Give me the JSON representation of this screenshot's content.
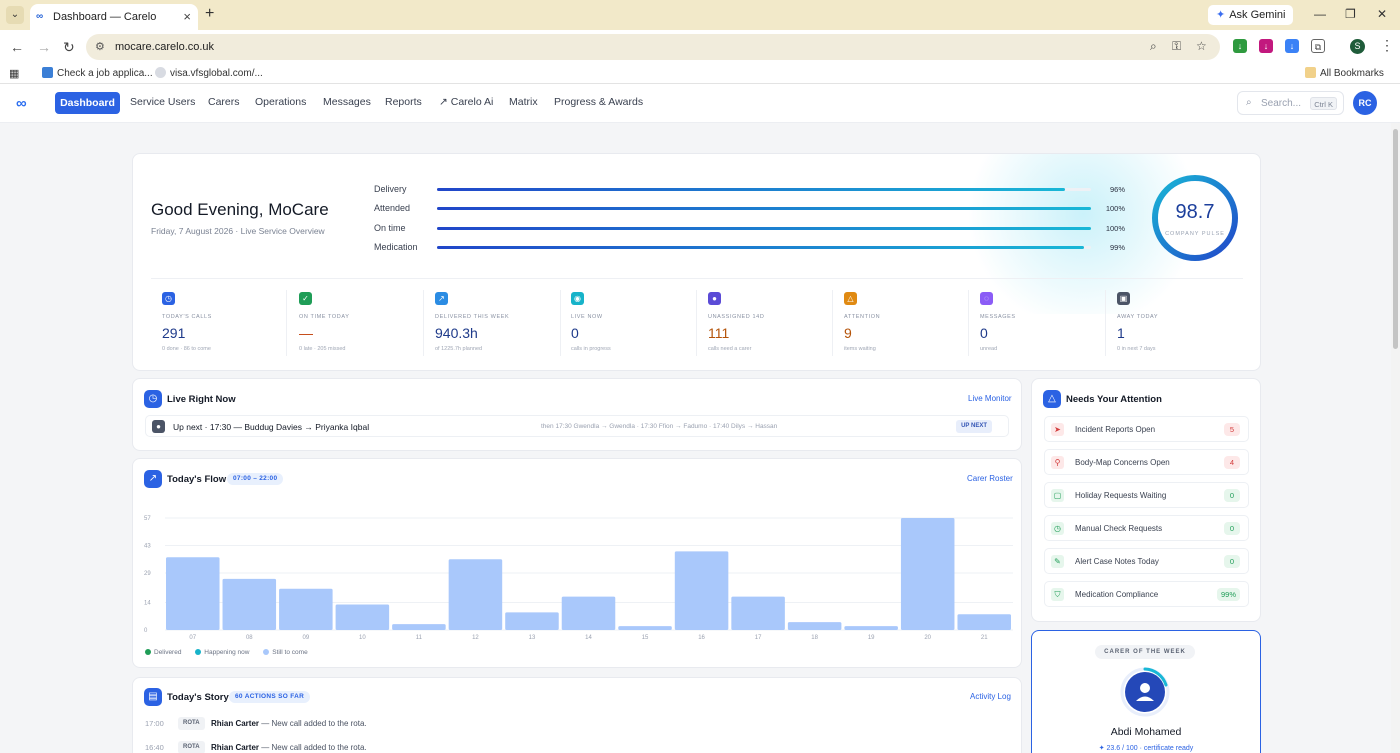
{
  "browser": {
    "tab_title": "Dashboard — Carelo",
    "url": "mocare.carelo.co.uk",
    "ask_gemini": "Ask Gemini",
    "profile_initial": "S",
    "bookmarks": [
      {
        "label": "Check a job applica..."
      },
      {
        "label": "visa.vfsglobal.com/..."
      }
    ],
    "all_bookmarks": "All Bookmarks"
  },
  "nav": {
    "items": [
      "Dashboard",
      "Service Users",
      "Carers",
      "Operations",
      "Messages",
      "Reports",
      "Carelo Ai",
      "Matrix",
      "Progress & Awards"
    ],
    "search_placeholder": "Search...",
    "search_shortcut": "Ctrl K",
    "avatar_initials": "RC"
  },
  "hero": {
    "greeting": "Good Evening, MoCare",
    "subtitle": "Friday, 7 August 2026 · Live Service Overview",
    "metrics": [
      {
        "label": "Delivery",
        "value": "96%",
        "pct": 96
      },
      {
        "label": "Attended",
        "value": "100%",
        "pct": 100
      },
      {
        "label": "On time",
        "value": "100%",
        "pct": 100
      },
      {
        "label": "Medication",
        "value": "99%",
        "pct": 99
      }
    ],
    "pulse_value": "98.7",
    "pulse_label": "COMPANY PULSE",
    "stats": [
      {
        "label": "TODAY'S CALLS",
        "value": "291",
        "sub": "0 done · 86 to come",
        "color": "#2b62e3"
      },
      {
        "label": "ON TIME TODAY",
        "value": "—",
        "sub": "0 late · 205 missed",
        "color": "#1f9d57"
      },
      {
        "label": "DELIVERED THIS WEEK",
        "value": "940.3h",
        "sub": "of 1225.7h planned",
        "color": "#2b8ce3"
      },
      {
        "label": "LIVE NOW",
        "value": "0",
        "sub": "calls in progress",
        "color": "#17b3c9"
      },
      {
        "label": "UNASSIGNED 14D",
        "value": "111",
        "sub": "calls need a carer",
        "color": "#5b4bd6"
      },
      {
        "label": "ATTENTION",
        "value": "9",
        "sub": "items waiting",
        "color": "#e08a12"
      },
      {
        "label": "MESSAGES",
        "value": "0",
        "sub": "unread",
        "color": "#8b5cf6"
      },
      {
        "label": "AWAY TODAY",
        "value": "1",
        "sub": "0 in next 7 days",
        "color": "#4b5466"
      }
    ]
  },
  "live": {
    "title": "Live Right Now",
    "link": "Live Monitor",
    "upnext": "Up next · 17:30 — Buddug Davies → Priyanka Iqbal",
    "then": "then 17:30 Gwendla → Gwendla · 17:30 Ffion → Fadumo · 17:40 Dilys → Hassan",
    "tag": "UP NEXT"
  },
  "flow": {
    "title": "Today's Flow",
    "range": "07:00 – 22:00",
    "link": "Carer Roster",
    "legend": [
      "Delivered",
      "Happening now",
      "Still to come"
    ]
  },
  "chart_data": {
    "type": "bar",
    "categories": [
      "07",
      "08",
      "09",
      "10",
      "11",
      "12",
      "13",
      "14",
      "15",
      "16",
      "17",
      "18",
      "19",
      "20",
      "21"
    ],
    "series": [
      {
        "values": [
          37,
          26,
          21,
          13,
          3,
          36,
          9,
          17,
          2,
          40,
          17,
          4,
          2,
          57,
          8
        ]
      }
    ],
    "yticks": [
      "0",
      "14",
      "29",
      "43",
      "57"
    ],
    "ylim": [
      0,
      57
    ],
    "grid": true
  },
  "story": {
    "title": "Today's Story",
    "count": "60 ACTIONS SO FAR",
    "link": "Activity Log",
    "rows": [
      {
        "time": "17:00",
        "tag": "ROTA",
        "name": "Rhian Carter",
        "text": " — New call added to the rota."
      },
      {
        "time": "16:40",
        "tag": "ROTA",
        "name": "Rhian Carter",
        "text": " — New call added to the rota."
      }
    ]
  },
  "attention": {
    "title": "Needs Your Attention",
    "items": [
      {
        "label": "Incident Reports Open",
        "count": "5",
        "tone": "red"
      },
      {
        "label": "Body-Map Concerns Open",
        "count": "4",
        "tone": "red"
      },
      {
        "label": "Holiday Requests Waiting",
        "count": "0",
        "tone": "green"
      },
      {
        "label": "Manual Check Requests",
        "count": "0",
        "tone": "green"
      },
      {
        "label": "Alert Case Notes Today",
        "count": "0",
        "tone": "green"
      },
      {
        "label": "Medication Compliance",
        "count": "99%",
        "tone": "green"
      }
    ]
  },
  "carer_of_week": {
    "label": "CARER OF THE WEEK",
    "name": "Abdi Mohamed",
    "detail": "✦ 23.6 / 100 · certificate ready"
  }
}
